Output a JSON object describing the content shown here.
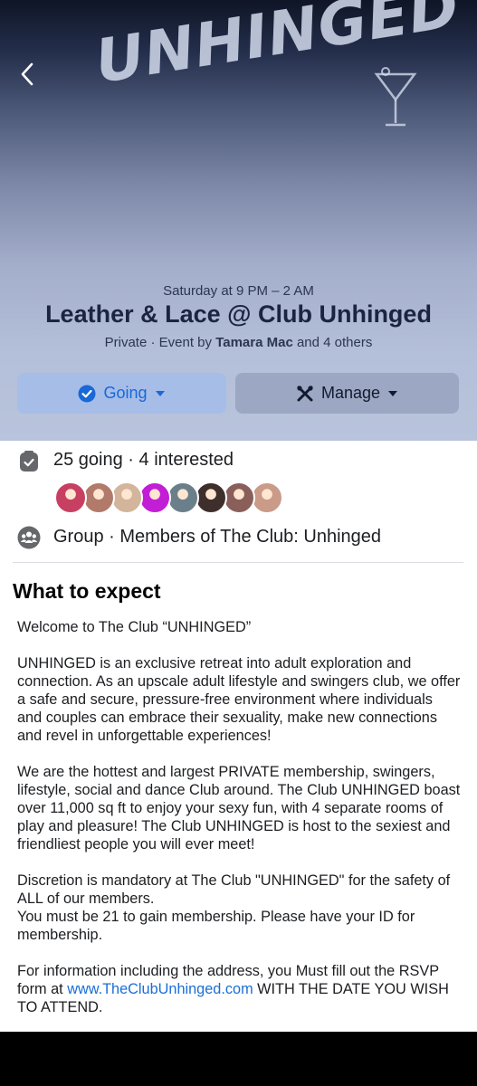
{
  "hero": {
    "logo_text": "UNHINGED",
    "date": "Saturday at 9 PM – 2 AM",
    "title": "Leather & Lace @ Club Unhinged",
    "privacy": "Private · Event by ",
    "host": "Tamara Mac",
    "others": " and 4 others"
  },
  "actions": {
    "going_label": "Going",
    "manage_label": "Manage"
  },
  "attendance": {
    "text": "25 going · 4 interested",
    "avatar_colors": [
      "#c74062",
      "#b27a6a",
      "#d2b59a",
      "#c21ed6",
      "#6a7f8a",
      "#3e2f2c",
      "#8a5f5a",
      "#c99b88"
    ]
  },
  "group": {
    "text": "Group · Members of The Club: Unhinged"
  },
  "about": {
    "heading": "What to expect",
    "p1": "Welcome to The Club “UNHINGED”",
    "p2": "UNHINGED is an exclusive retreat into adult exploration and connection. As an upscale adult lifestyle and swingers club, we offer a safe and secure, pressure-free environment where individuals and couples can embrace their sexuality, make new connections and revel in unforgettable experiences!",
    "p3": "We are the hottest and largest PRIVATE membership, swingers, lifestyle, social and dance Club around. The Club UNHINGED boast over 11,000 sq ft to enjoy your sexy fun, with 4 separate rooms of play and pleasure! The Club UNHINGED is host to the sexiest and friendliest people you will ever meet!",
    "p4a": "Discretion is mandatory at The Club \"UNHINGED\" for the safety of ALL of our members.",
    "p4b": "You must be 21 to gain membership. Please have your ID for membership.",
    "p5_before": "For information including the address, you Must fill out the RSVP form at ",
    "p5_link": "www.TheClubUnhinged.com",
    "p5_after": " WITH THE DATE YOU WISH TO ATTEND."
  },
  "colors": {
    "link": "#1a6ed8",
    "going_bg": "#a6bde8",
    "manage_bg": "#9ba7c3"
  }
}
